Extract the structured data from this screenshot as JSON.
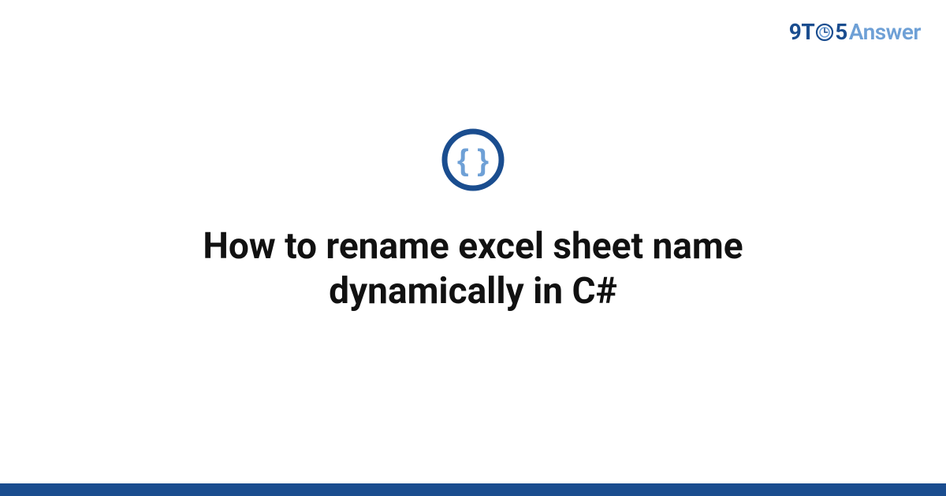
{
  "brand": {
    "part1": "9T",
    "part2": "5",
    "part3": "Answer"
  },
  "title": "How to rename excel sheet name dynamically in C#",
  "colors": {
    "primary": "#1a4d8f",
    "accent": "#6ea0d6"
  }
}
